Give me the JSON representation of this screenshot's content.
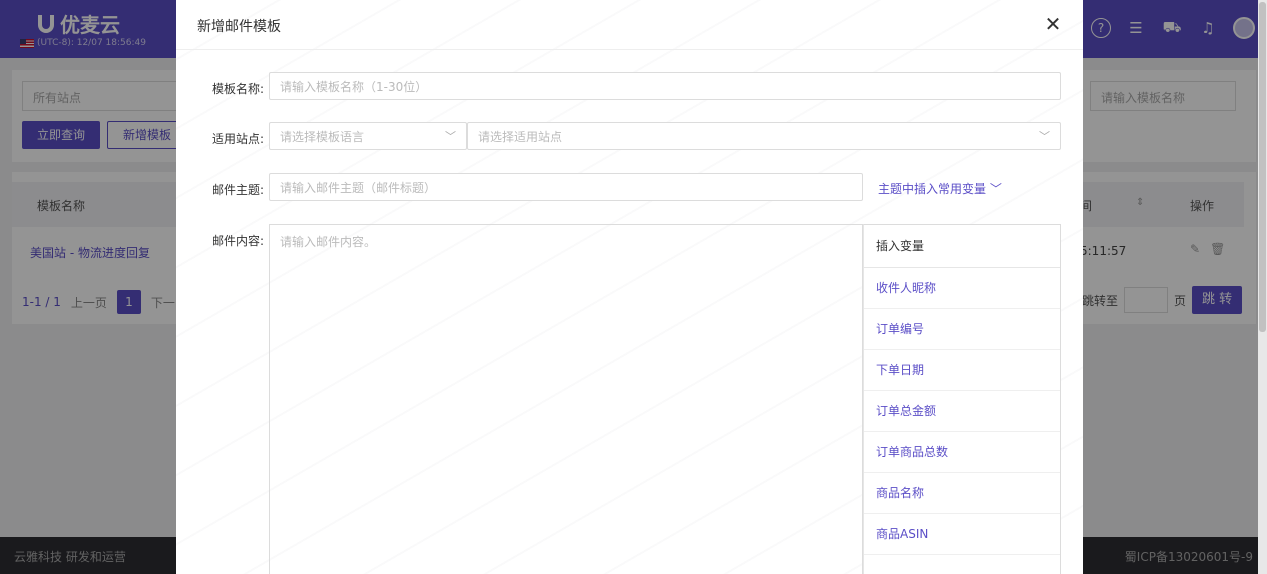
{
  "app": {
    "logo_text": "优麦云",
    "timezone_text": "(UTC-8): 12/07 18:56:49"
  },
  "background": {
    "site_filter_placeholder": "所有站点",
    "query_button": "立即查询",
    "add_template_button": "新增模板",
    "template_search_placeholder": "请输入模板名称",
    "table": {
      "col_name": "模板名称",
      "col_time": "间",
      "col_sort": "⇕",
      "col_ops": "操作",
      "rows": [
        {
          "name": "美国站 - 物流进度回复",
          "time": "5:11:57"
        }
      ]
    },
    "pager": {
      "total": "1-1 / 1",
      "prev": "上一页",
      "current": "1",
      "next": "下一",
      "jump_label": "跳转至",
      "page_unit": "页",
      "jump_button": "跳 转"
    },
    "footer": {
      "left": "云雅科技 研发和运营",
      "right": "蜀ICP备13020601号-9"
    }
  },
  "modal": {
    "title": "新增邮件模板",
    "close_symbol": "✕",
    "template_name": {
      "label": "模板名称:",
      "placeholder": "请输入模板名称（1-30位）"
    },
    "site": {
      "label": "适用站点:",
      "language_placeholder": "请选择模板语言",
      "site_placeholder": "请选择适用站点"
    },
    "subject": {
      "label": "邮件主题:",
      "placeholder": "请输入邮件主题（邮件标题）",
      "insert_link": "主题中插入常用变量"
    },
    "content": {
      "label": "邮件内容:",
      "placeholder": "请输入邮件内容。"
    },
    "variables": {
      "header": "插入变量",
      "items": [
        "收件人昵称",
        "订单编号",
        "下单日期",
        "订单总金额",
        "订单商品总数",
        "商品名称",
        "商品ASIN"
      ]
    }
  },
  "colors": {
    "brand": "#5b4ec7",
    "footer_bg": "#2d2d33"
  }
}
